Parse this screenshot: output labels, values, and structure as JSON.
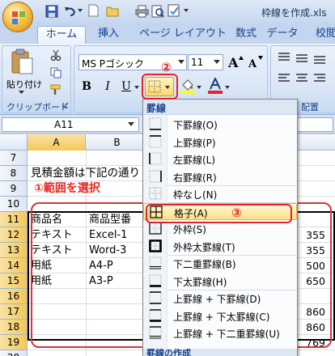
{
  "window": {
    "title": "枠線を作成.xls"
  },
  "tabs": [
    "ホーム",
    "挿入",
    "ページ レイアウト",
    "数式",
    "データ",
    "校閲"
  ],
  "ribbon": {
    "clipboard": {
      "paste_label": "貼り付け",
      "group_label": "クリップボード"
    },
    "font": {
      "name": "MS Pゴシック",
      "size": "11",
      "grow": "A",
      "shrink": "A",
      "bold": "B",
      "italic": "I",
      "underline": "U"
    },
    "alignment": {
      "group_label": "配置"
    }
  },
  "formula_bar": {
    "name_box": "A11",
    "fx": ""
  },
  "sheet": {
    "columns": [
      "A",
      "B"
    ],
    "rows": [
      "7",
      "8",
      "9",
      "10",
      "11",
      "12",
      "13",
      "14",
      "15",
      "16",
      "17",
      "18",
      "19",
      "20"
    ],
    "row8_text": "見積金額は下記の通り",
    "row9_annotation": "①範囲を選択",
    "table": [
      {
        "a": "商品名",
        "b": "商品型番",
        "num": ""
      },
      {
        "a": "テキスト",
        "b": "Excel-1",
        "num": "355"
      },
      {
        "a": "テキスト",
        "b": "Word-3",
        "num": "355"
      },
      {
        "a": "用紙",
        "b": "A4-P",
        "num": "500"
      },
      {
        "a": "用紙",
        "b": "A3-P",
        "num": "650"
      }
    ],
    "totals": [
      "860",
      "860",
      "769"
    ]
  },
  "border_menu": {
    "header": "罫線",
    "items": [
      {
        "label": "下罫線(O)",
        "icon": "border-bottom-icon"
      },
      {
        "label": "上罫線(P)",
        "icon": "border-top-icon"
      },
      {
        "label": "左罫線(L)",
        "icon": "border-left-icon"
      },
      {
        "label": "右罫線(R)",
        "icon": "border-right-icon"
      },
      {
        "label": "枠なし(N)",
        "icon": "border-none-icon"
      },
      {
        "label": "格子(A)",
        "icon": "border-all-icon"
      },
      {
        "label": "外枠(S)",
        "icon": "border-outside-icon"
      },
      {
        "label": "外枠太罫線(T)",
        "icon": "border-thick-outside-icon"
      },
      {
        "label": "下二重罫線(B)",
        "icon": "border-double-bottom-icon"
      },
      {
        "label": "下太罫線(H)",
        "icon": "border-thick-bottom-icon"
      },
      {
        "label": "上罫線 + 下罫線(D)",
        "icon": "border-top-bottom-icon"
      },
      {
        "label": "上罫線 + 下太罫線(C)",
        "icon": "border-top-thick-bottom-icon"
      },
      {
        "label": "上罫線 + 下二重罫線(U)",
        "icon": "border-top-double-bottom-icon"
      }
    ],
    "footer": "罫線の作成"
  },
  "annotations": {
    "step2": "②",
    "step3": "③"
  },
  "colors": {
    "annotation_red": "#e0262b",
    "highlight": "#ffe08a",
    "accent": "#15428b"
  }
}
